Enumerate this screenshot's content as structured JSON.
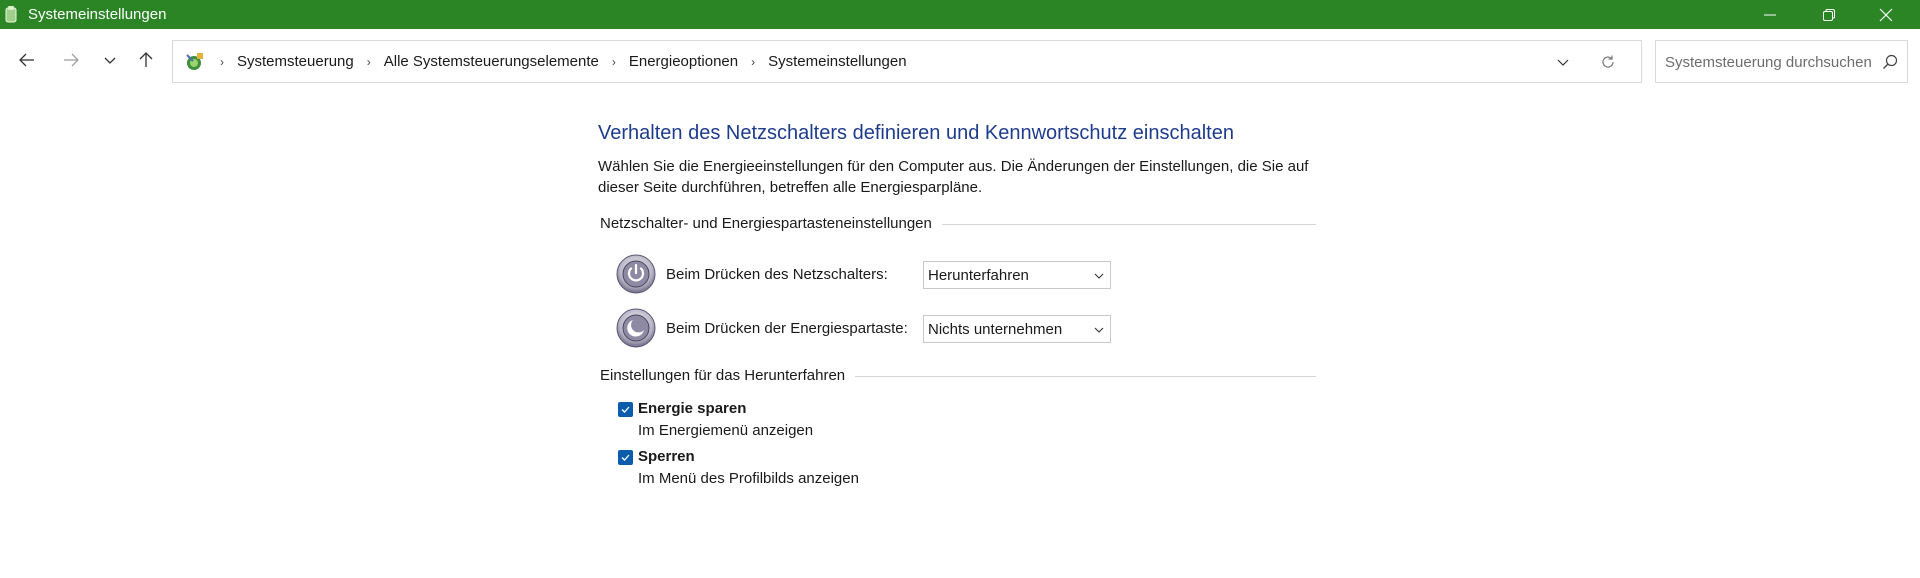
{
  "window": {
    "title": "Systemeinstellungen"
  },
  "breadcrumb": {
    "items": [
      "Systemsteuerung",
      "Alle Systemsteuerungselemente",
      "Energieoptionen",
      "Systemeinstellungen"
    ]
  },
  "search": {
    "placeholder": "Systemsteuerung durchsuchen"
  },
  "main": {
    "title": "Verhalten des Netzschalters definieren und Kennwortschutz einschalten",
    "description": "Wählen Sie die Energieeinstellungen für den Computer aus. Die Änderungen der Einstellungen, die Sie auf dieser Seite durchführen, betreffen alle Energiesparpläne.",
    "power_group": {
      "header": "Netzschalter- und Energiespartasteneinstellungen",
      "rows": [
        {
          "label": "Beim Drücken des Netzschalters:",
          "value": "Herunterfahren"
        },
        {
          "label": "Beim Drücken der Energiespartaste:",
          "value": "Nichts unternehmen"
        }
      ]
    },
    "shutdown_group": {
      "header": "Einstellungen für das Herunterfahren",
      "items": [
        {
          "title": "Energie sparen",
          "subtitle": "Im Energiemenü anzeigen",
          "checked": true
        },
        {
          "title": "Sperren",
          "subtitle": "Im Menü des Profilbilds anzeigen",
          "checked": true
        }
      ]
    }
  },
  "colors": {
    "titlebar": "#2b8525",
    "heading": "#1e3c8c",
    "checkbox": "#0b5cad"
  },
  "icons": {
    "app": "control-panel-icon",
    "nav": [
      "back-arrow-icon",
      "forward-arrow-icon",
      "chevron-down-icon",
      "up-arrow-icon"
    ],
    "power": "power-button-icon",
    "sleep": "sleep-button-icon",
    "search": "search-icon",
    "refresh": "refresh-icon"
  }
}
